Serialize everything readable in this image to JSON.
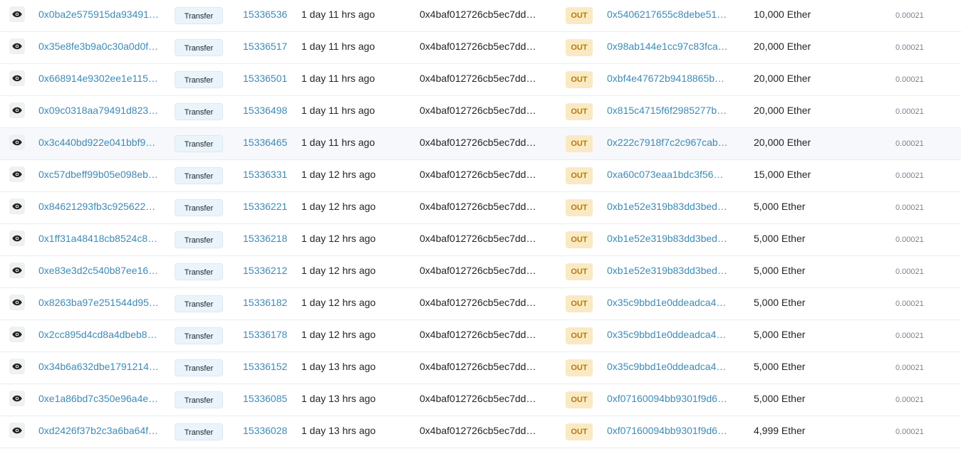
{
  "method_label": "Transfer",
  "direction_label": "OUT",
  "eye_icon": "eye-icon",
  "highlight_row": 4,
  "rows": [
    {
      "hash": "0x0ba2e575915da93491…",
      "block": "15336536",
      "age": "1 day 11 hrs ago",
      "from": "0x4baf012726cb5ec7dd…",
      "to": "0x5406217655c8debe51…",
      "value": "10,000 Ether",
      "fee": "0.00021"
    },
    {
      "hash": "0x35e8fe3b9a0c30a0d0f…",
      "block": "15336517",
      "age": "1 day 11 hrs ago",
      "from": "0x4baf012726cb5ec7dd…",
      "to": "0x98ab144e1cc97c83fca…",
      "value": "20,000 Ether",
      "fee": "0.00021"
    },
    {
      "hash": "0x668914e9302ee1e115…",
      "block": "15336501",
      "age": "1 day 11 hrs ago",
      "from": "0x4baf012726cb5ec7dd…",
      "to": "0xbf4e47672b9418865b…",
      "value": "20,000 Ether",
      "fee": "0.00021"
    },
    {
      "hash": "0x09c0318aa79491d823…",
      "block": "15336498",
      "age": "1 day 11 hrs ago",
      "from": "0x4baf012726cb5ec7dd…",
      "to": "0x815c4715f6f2985277b…",
      "value": "20,000 Ether",
      "fee": "0.00021"
    },
    {
      "hash": "0x3c440bd922e041bbf9…",
      "block": "15336465",
      "age": "1 day 11 hrs ago",
      "from": "0x4baf012726cb5ec7dd…",
      "to": "0x222c7918f7c2c967cab…",
      "value": "20,000 Ether",
      "fee": "0.00021"
    },
    {
      "hash": "0xc57dbeff99b05e098eb…",
      "block": "15336331",
      "age": "1 day 12 hrs ago",
      "from": "0x4baf012726cb5ec7dd…",
      "to": "0xa60c073eaa1bdc3f56…",
      "value": "15,000 Ether",
      "fee": "0.00021"
    },
    {
      "hash": "0x84621293fb3c925622…",
      "block": "15336221",
      "age": "1 day 12 hrs ago",
      "from": "0x4baf012726cb5ec7dd…",
      "to": "0xb1e52e319b83dd3bed…",
      "value": "5,000 Ether",
      "fee": "0.00021"
    },
    {
      "hash": "0x1ff31a48418cb8524c8…",
      "block": "15336218",
      "age": "1 day 12 hrs ago",
      "from": "0x4baf012726cb5ec7dd…",
      "to": "0xb1e52e319b83dd3bed…",
      "value": "5,000 Ether",
      "fee": "0.00021"
    },
    {
      "hash": "0xe83e3d2c540b87ee16…",
      "block": "15336212",
      "age": "1 day 12 hrs ago",
      "from": "0x4baf012726cb5ec7dd…",
      "to": "0xb1e52e319b83dd3bed…",
      "value": "5,000 Ether",
      "fee": "0.00021"
    },
    {
      "hash": "0x8263ba97e251544d95…",
      "block": "15336182",
      "age": "1 day 12 hrs ago",
      "from": "0x4baf012726cb5ec7dd…",
      "to": "0x35c9bbd1e0ddeadca4…",
      "value": "5,000 Ether",
      "fee": "0.00021"
    },
    {
      "hash": "0x2cc895d4cd8a4dbeb8…",
      "block": "15336178",
      "age": "1 day 12 hrs ago",
      "from": "0x4baf012726cb5ec7dd…",
      "to": "0x35c9bbd1e0ddeadca4…",
      "value": "5,000 Ether",
      "fee": "0.00021"
    },
    {
      "hash": "0x34b6a632dbe1791214…",
      "block": "15336152",
      "age": "1 day 13 hrs ago",
      "from": "0x4baf012726cb5ec7dd…",
      "to": "0x35c9bbd1e0ddeadca4…",
      "value": "5,000 Ether",
      "fee": "0.00021"
    },
    {
      "hash": "0xe1a86bd7c350e96a4e…",
      "block": "15336085",
      "age": "1 day 13 hrs ago",
      "from": "0x4baf012726cb5ec7dd…",
      "to": "0xf07160094bb9301f9d6…",
      "value": "5,000 Ether",
      "fee": "0.00021"
    },
    {
      "hash": "0xd2426f37b2c3a6ba64f…",
      "block": "15336028",
      "age": "1 day 13 hrs ago",
      "from": "0x4baf012726cb5ec7dd…",
      "to": "0xf07160094bb9301f9d6…",
      "value": "4,999 Ether",
      "fee": "0.00021"
    }
  ]
}
